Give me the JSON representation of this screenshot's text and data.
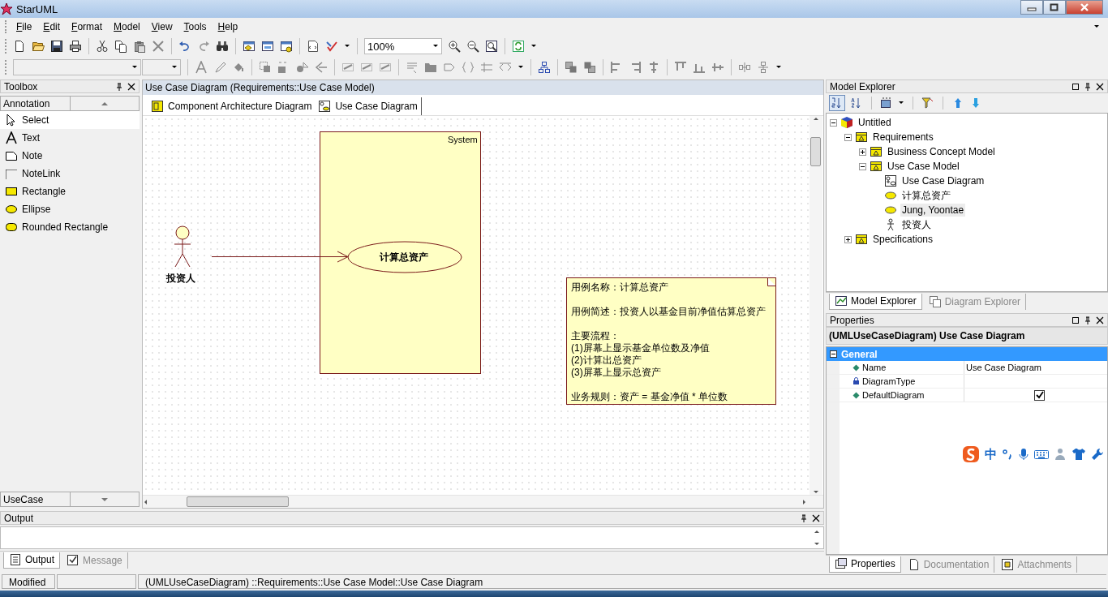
{
  "window": {
    "title": "StarUML"
  },
  "menu": [
    "File",
    "Edit",
    "Format",
    "Model",
    "View",
    "Tools",
    "Help"
  ],
  "toolbar": {
    "zoom": "100%"
  },
  "toolbox": {
    "title": "Toolbox",
    "category": "Annotation",
    "bottom_category": "UseCase",
    "items": [
      {
        "label": "Select",
        "kind": "pointer",
        "selected": true
      },
      {
        "label": "Text",
        "kind": "text",
        "selected": false
      },
      {
        "label": "Note",
        "kind": "note",
        "selected": false
      },
      {
        "label": "NoteLink",
        "kind": "notelink",
        "selected": false
      },
      {
        "label": "Rectangle",
        "kind": "rectangle",
        "selected": false
      },
      {
        "label": "Ellipse",
        "kind": "ellipse",
        "selected": false
      },
      {
        "label": "Rounded Rectangle",
        "kind": "rounded",
        "selected": false
      }
    ]
  },
  "diagram": {
    "header": "Use Case Diagram (Requirements::Use Case Model)",
    "tabs": [
      {
        "label": "Component Architecture Diagram",
        "kind": "component",
        "selected": false
      },
      {
        "label": "Use Case Diagram",
        "kind": "usecase",
        "selected": true
      }
    ],
    "system": "System",
    "actor": "投资人",
    "use_case": "计算总资产",
    "note": [
      [
        "用例名称：计算总资产"
      ],
      [
        "用例简述：投资人以基金目前净值估算总资产"
      ],
      [
        "主要流程：",
        "(1)屏幕上显示基金单位数及净值",
        "(2)计算出总资产",
        "(3)屏幕上显示总资产"
      ],
      [
        "业务规则：资产 = 基金净值 * 单位数"
      ]
    ]
  },
  "model_explorer": {
    "title": "Model Explorer",
    "tree": [
      {
        "label": "Untitled",
        "kind": "project",
        "selected": false,
        "expanded": true,
        "children": [
          {
            "label": "Requirements",
            "kind": "package",
            "selected": false,
            "expanded": true,
            "children": [
              {
                "label": "Business Concept Model",
                "kind": "package",
                "selected": false,
                "expanded": false
              },
              {
                "label": "Use Case Model",
                "kind": "package",
                "selected": false,
                "expanded": true,
                "children": [
                  {
                    "label": "Use Case Diagram",
                    "kind": "diagram",
                    "selected": false
                  },
                  {
                    "label": "计算总资产",
                    "kind": "usecase",
                    "selected": false
                  },
                  {
                    "label": "Jung, Yoontae",
                    "kind": "usecase",
                    "selected": true
                  },
                  {
                    "label": "投资人",
                    "kind": "actor",
                    "selected": false
                  }
                ]
              }
            ]
          },
          {
            "label": "Specifications",
            "kind": "package",
            "selected": false,
            "expanded": false
          }
        ]
      }
    ],
    "tabs": [
      {
        "label": "Model Explorer",
        "selected": true
      },
      {
        "label": "Diagram Explorer",
        "selected": false
      }
    ]
  },
  "properties": {
    "title": "Properties",
    "heading": "(UMLUseCaseDiagram) Use Case Diagram",
    "group": {
      "label": "General",
      "expanded": true
    },
    "rows": [
      {
        "name": "Name",
        "locked": false,
        "kind": "text",
        "value": "Use Case Diagram"
      },
      {
        "name": "DiagramType",
        "locked": true,
        "kind": "text"
      },
      {
        "name": "DefaultDiagram",
        "locked": false,
        "kind": "checkbox",
        "checked": true
      }
    ],
    "tabs": [
      {
        "label": "Properties",
        "selected": true
      },
      {
        "label": "Documentation",
        "selected": false
      },
      {
        "label": "Attachments",
        "selected": false
      }
    ]
  },
  "output": {
    "title": "Output",
    "tabs": [
      {
        "label": "Output",
        "selected": true
      },
      {
        "label": "Message",
        "selected": false
      }
    ]
  },
  "status_bar": {
    "state": "Modified",
    "path": "(UMLUseCaseDiagram) ::Requirements::Use Case Model::Use Case Diagram"
  },
  "ime_bar": {
    "mode": "中"
  }
}
